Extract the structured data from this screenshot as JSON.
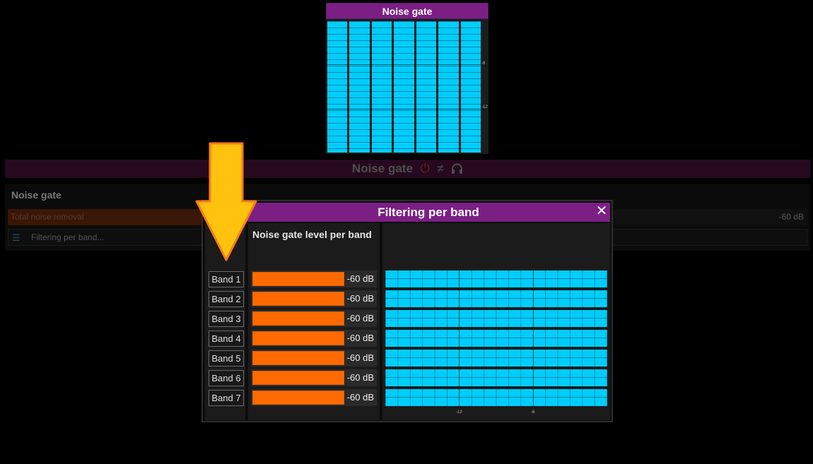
{
  "top_meter": {
    "title": "Noise gate",
    "column_count": 7,
    "scale_ticks": [
      "-6",
      "-12"
    ],
    "color": "#00cdfa"
  },
  "header": {
    "title": "Noise gate",
    "icons": [
      "power-icon",
      "not-equal-icon",
      "headphones-icon"
    ]
  },
  "panel": {
    "title": "Noise gate",
    "total_noise_removal": {
      "label": "Total noise removal",
      "value": "-60 dB"
    },
    "filtering_button": {
      "label": "Filtering per band...",
      "icon": "checklist-icon"
    }
  },
  "dialog": {
    "title": "Filtering per band",
    "close_label": "✕",
    "level_column_title": "Noise gate level per band",
    "bands": [
      {
        "label": "Band 1",
        "level": "-60 dB"
      },
      {
        "label": "Band 2",
        "level": "-60 dB"
      },
      {
        "label": "Band 3",
        "level": "-60 dB"
      },
      {
        "label": "Band 4",
        "level": "-60 dB"
      },
      {
        "label": "Band 5",
        "level": "-60 dB"
      },
      {
        "label": "Band 6",
        "level": "-60 dB"
      },
      {
        "label": "Band 7",
        "level": "-60 dB"
      }
    ],
    "graph_ticks": [
      "-12",
      "-6"
    ],
    "level_color": "#ff6a00",
    "graph_color": "#00cdfa"
  },
  "annotation": {
    "arrow_color": "#ffc20e",
    "arrow_outline": "#ff7a1a"
  }
}
